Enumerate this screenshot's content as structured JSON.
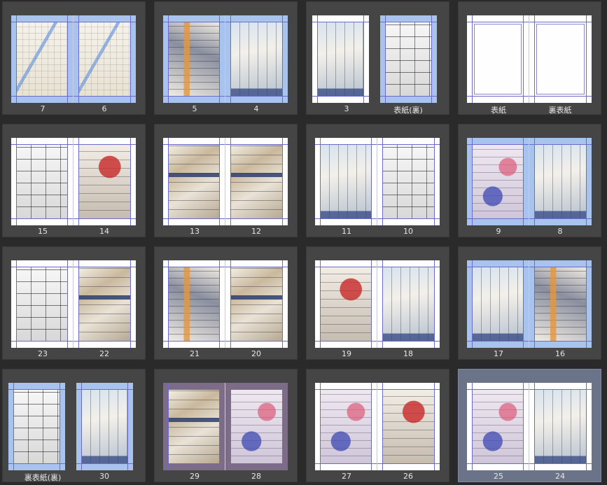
{
  "spreads": [
    {
      "left_page": "7",
      "right_page": "6",
      "style": "blue",
      "art_l": "map",
      "art_r": "map",
      "selected": false
    },
    {
      "left_page": "5",
      "right_page": "4",
      "style": "blue",
      "art_l": "color-b",
      "art_r": "color-c",
      "selected": false
    },
    {
      "left_page": "3",
      "right_page": "表紙(裏)",
      "style": "single",
      "art_l": "color-c",
      "art_r": "manga",
      "selected": false
    },
    {
      "left_page": "表紙",
      "right_page": "裏表紙",
      "style": "blank",
      "art_l": "blank",
      "art_r": "blank",
      "selected": false
    },
    {
      "left_page": "15",
      "right_page": "14",
      "style": "white",
      "art_l": "manga",
      "art_r": "color-d",
      "selected": false
    },
    {
      "left_page": "13",
      "right_page": "12",
      "style": "white",
      "art_l": "color-a",
      "art_r": "color-a",
      "selected": false
    },
    {
      "left_page": "11",
      "right_page": "10",
      "style": "white",
      "art_l": "color-c",
      "art_r": "manga",
      "selected": false
    },
    {
      "left_page": "9",
      "right_page": "8",
      "style": "blue",
      "art_l": "color-e",
      "art_r": "color-c",
      "selected": false
    },
    {
      "left_page": "23",
      "right_page": "22",
      "style": "white",
      "art_l": "manga",
      "art_r": "color-a",
      "selected": false
    },
    {
      "left_page": "21",
      "right_page": "20",
      "style": "white",
      "art_l": "color-b",
      "art_r": "color-a",
      "selected": false
    },
    {
      "left_page": "19",
      "right_page": "18",
      "style": "white",
      "art_l": "color-d",
      "art_r": "color-c",
      "selected": false
    },
    {
      "left_page": "17",
      "right_page": "16",
      "style": "blue",
      "art_l": "color-c",
      "art_r": "color-b",
      "selected": false
    },
    {
      "left_page": "裏表紙(裏)",
      "right_page": "30",
      "style": "single-blue",
      "art_l": "manga",
      "art_r": "color-c",
      "selected": false
    },
    {
      "left_page": "29",
      "right_page": "28",
      "style": "violet",
      "art_l": "color-a",
      "art_r": "color-e",
      "selected": false
    },
    {
      "left_page": "27",
      "right_page": "26",
      "style": "white",
      "art_l": "color-e",
      "art_r": "color-d",
      "selected": false
    },
    {
      "left_page": "25",
      "right_page": "24",
      "style": "white",
      "art_l": "color-e",
      "art_r": "color-c",
      "selected": true
    }
  ]
}
